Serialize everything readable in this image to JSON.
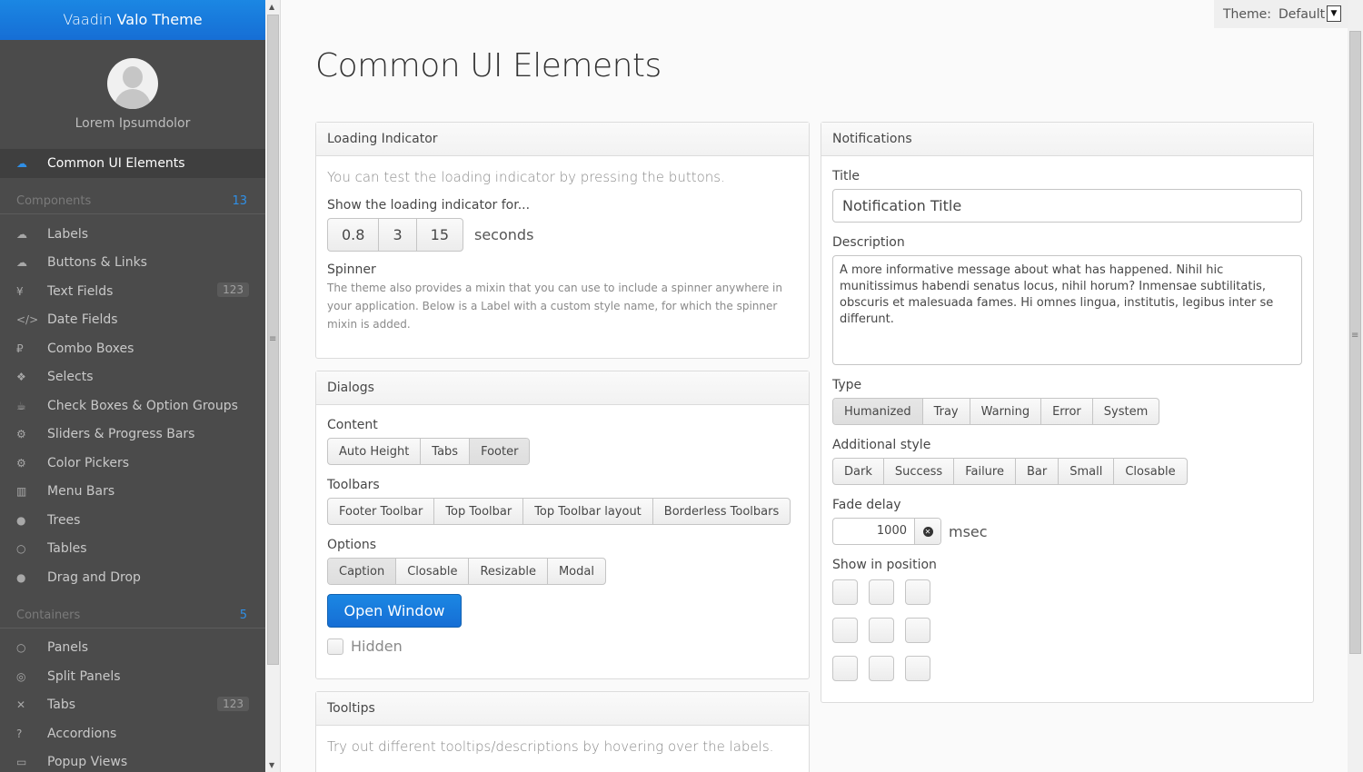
{
  "app": {
    "brand_light": "Vaadin",
    "brand_bold": "Valo Theme"
  },
  "user": {
    "name": "Lorem Ipsumdolor"
  },
  "nav": {
    "selected": {
      "label": "Common UI Elements",
      "icon": "cloud-icon"
    },
    "components_caption": "Components",
    "components_count": "13",
    "components": [
      {
        "label": "Labels",
        "icon": "cloud-upload-icon",
        "glyph": "☁"
      },
      {
        "label": "Buttons & Links",
        "icon": "cloud-upload-icon",
        "glyph": "☁"
      },
      {
        "label": "Text Fields",
        "icon": "yen-icon",
        "glyph": "¥",
        "badge": "123"
      },
      {
        "label": "Date Fields",
        "icon": "code-icon",
        "glyph": "</>"
      },
      {
        "label": "Combo Boxes",
        "icon": "ruble-icon",
        "glyph": "₽"
      },
      {
        "label": "Selects",
        "icon": "dropbox-icon",
        "glyph": "❖"
      },
      {
        "label": "Check Boxes & Option Groups",
        "icon": "coffee-icon",
        "glyph": "☕"
      },
      {
        "label": "Sliders & Progress Bars",
        "icon": "gear-icon",
        "glyph": "⚙"
      },
      {
        "label": "Color Pickers",
        "icon": "gears-icon",
        "glyph": "⚙"
      },
      {
        "label": "Menu Bars",
        "icon": "columns-icon",
        "glyph": "▥"
      },
      {
        "label": "Trees",
        "icon": "comment-icon",
        "glyph": "●"
      },
      {
        "label": "Tables",
        "icon": "comment-outline-icon",
        "glyph": "○"
      },
      {
        "label": "Drag and Drop",
        "icon": "comments-icon",
        "glyph": "●"
      }
    ],
    "containers_caption": "Containers",
    "containers_count": "5",
    "containers": [
      {
        "label": "Panels",
        "icon": "comments-outline-icon",
        "glyph": "○"
      },
      {
        "label": "Split Panels",
        "icon": "compass-icon",
        "glyph": "◎"
      },
      {
        "label": "Tabs",
        "icon": "compress-icon",
        "glyph": "✕",
        "badge": "123"
      },
      {
        "label": "Accordions",
        "icon": "question-icon",
        "glyph": "?"
      },
      {
        "label": "Popup Views",
        "icon": "credit-card-icon",
        "glyph": "▭"
      }
    ]
  },
  "theme": {
    "label": "Theme:",
    "value": "Default"
  },
  "page": {
    "title": "Common UI Elements"
  },
  "loading": {
    "title": "Loading Indicator",
    "intro": "You can test the loading indicator by pressing the buttons.",
    "show_caption": "Show the loading indicator for...",
    "buttons": [
      "0.8",
      "3",
      "15"
    ],
    "unit": "seconds",
    "spinner_caption": "Spinner",
    "spinner_text": "The theme also provides a mixin that you can use to include a spinner anywhere in your application. Below is a Label with a custom style name, for which the spinner mixin is added."
  },
  "dialogs": {
    "title": "Dialogs",
    "content_caption": "Content",
    "content_buttons": [
      "Auto Height",
      "Tabs",
      "Footer"
    ],
    "toolbars_caption": "Toolbars",
    "toolbar_buttons": [
      "Footer Toolbar",
      "Top Toolbar",
      "Top Toolbar layout",
      "Borderless Toolbars"
    ],
    "options_caption": "Options",
    "option_buttons": [
      "Caption",
      "Closable",
      "Resizable",
      "Modal"
    ],
    "open_button": "Open Window",
    "hidden_label": "Hidden"
  },
  "tooltips": {
    "title": "Tooltips",
    "text": "Try out different tooltips/descriptions by hovering over the labels."
  },
  "notifications": {
    "title": "Notifications",
    "title_caption": "Title",
    "title_value": "Notification Title",
    "description_caption": "Description",
    "description_value": "A more informative message about what has happened. Nihil hic munitissimus habendi senatus locus, nihil horum? Inmensae subtilitatis, obscuris et malesuada fames. Hi omnes lingua, institutis, legibus inter se differunt.",
    "type_caption": "Type",
    "type_buttons": [
      "Humanized",
      "Tray",
      "Warning",
      "Error",
      "System"
    ],
    "style_caption": "Additional style",
    "style_buttons": [
      "Dark",
      "Success",
      "Failure",
      "Bar",
      "Small",
      "Closable"
    ],
    "fade_caption": "Fade delay",
    "fade_value": "1000",
    "fade_unit": "msec",
    "position_caption": "Show in position"
  }
}
